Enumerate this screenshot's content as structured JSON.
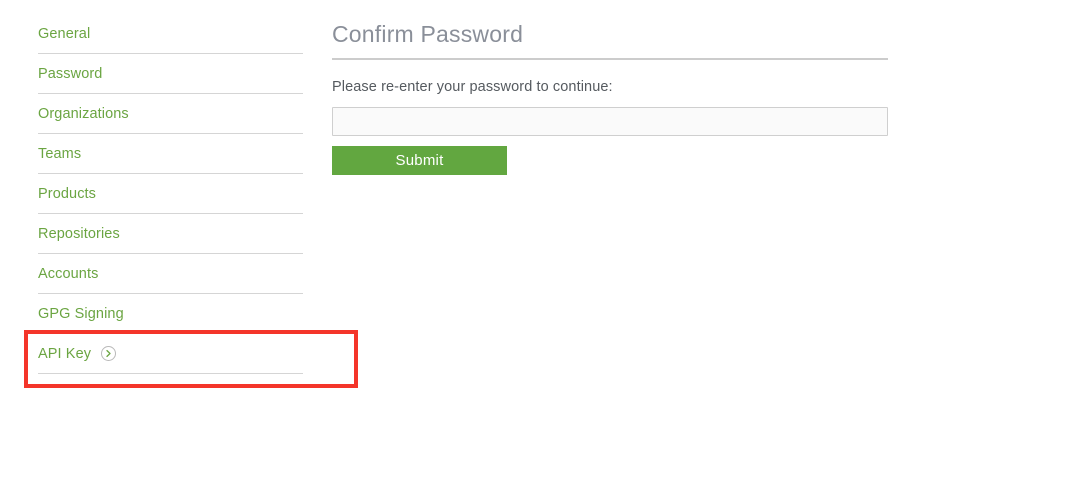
{
  "colors": {
    "nav_link": "#6ba542",
    "heading": "#8a8f99",
    "body_text": "#555a5f",
    "submit_green": "#62a740",
    "highlight_red": "#f4352a",
    "divider": "#d5d5d5",
    "input_border": "#cfcfcf",
    "input_fill": "#fafafa"
  },
  "sidebar": {
    "items": [
      {
        "label": "General",
        "icon": "",
        "current": false
      },
      {
        "label": "Password",
        "icon": "",
        "current": false
      },
      {
        "label": "Organizations",
        "icon": "",
        "current": false
      },
      {
        "label": "Teams",
        "icon": "",
        "current": false
      },
      {
        "label": "Products",
        "icon": "",
        "current": false
      },
      {
        "label": "Repositories",
        "icon": "",
        "current": false
      },
      {
        "label": "Accounts",
        "icon": "",
        "current": false
      },
      {
        "label": "GPG Signing",
        "icon": "",
        "current": false
      },
      {
        "label": "API Key",
        "icon": "chevron-right-circle-icon",
        "current": true
      }
    ]
  },
  "annotation": {
    "target": "API Key",
    "shape": "rectangle",
    "color": "#f4352a"
  },
  "main": {
    "title": "Confirm Password",
    "instruction": "Please re-enter your password to continue:",
    "password_field": {
      "value": "",
      "placeholder": "",
      "type": "password"
    },
    "submit_label": "Submit"
  }
}
